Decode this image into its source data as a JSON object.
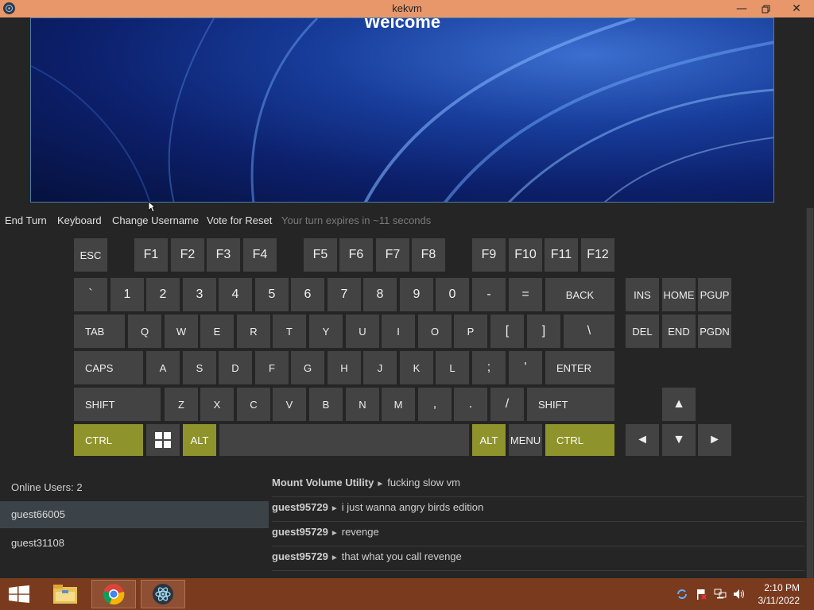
{
  "window": {
    "title": "kekvm"
  },
  "vm": {
    "welcome_text": "Welcome"
  },
  "toolbar": {
    "end_turn": "End Turn",
    "keyboard": "Keyboard",
    "change_username": "Change Username",
    "vote_reset": "Vote for Reset",
    "status": "Your turn expires in ~11 seconds"
  },
  "keyboard": {
    "rows": {
      "fn": [
        "ESC",
        "F1",
        "F2",
        "F3",
        "F4",
        "F5",
        "F6",
        "F7",
        "F8",
        "F9",
        "F10",
        "F11",
        "F12"
      ],
      "num": [
        "`",
        "1",
        "2",
        "3",
        "4",
        "5",
        "6",
        "7",
        "8",
        "9",
        "0",
        "-",
        "=",
        "BACK"
      ],
      "tab": [
        "TAB",
        "Q",
        "W",
        "E",
        "R",
        "T",
        "Y",
        "U",
        "I",
        "O",
        "P",
        "[",
        "]",
        "\\"
      ],
      "caps": [
        "CAPS",
        "A",
        "S",
        "D",
        "F",
        "G",
        "H",
        "J",
        "K",
        "L",
        ";",
        "'",
        "ENTER"
      ],
      "shift": [
        "SHIFT",
        "Z",
        "X",
        "C",
        "V",
        "B",
        "N",
        "M",
        ",",
        ".",
        "/",
        "SHIFT"
      ],
      "bottom": [
        "CTRL",
        "ALT",
        "ALT",
        "MENU",
        "CTRL"
      ]
    },
    "nav": [
      "INS",
      "HOME",
      "PGUP",
      "DEL",
      "END",
      "PGDN"
    ],
    "arrows": [
      "▲",
      "◄",
      "▼",
      "►"
    ],
    "active_color": "#8f932b"
  },
  "users": {
    "count_label": "Online Users: 2",
    "list": [
      "guest66005",
      "guest31108"
    ]
  },
  "chat": [
    {
      "user": "Mount Volume Utility",
      "text": "fucking slow vm"
    },
    {
      "user": "guest95729",
      "text": "i just wanna angry birds edition"
    },
    {
      "user": "guest95729",
      "text": "revenge"
    },
    {
      "user": "guest95729",
      "text": "that what you call revenge"
    }
  ],
  "taskbar": {
    "time": "2:10 PM",
    "date": "3/11/2022"
  }
}
